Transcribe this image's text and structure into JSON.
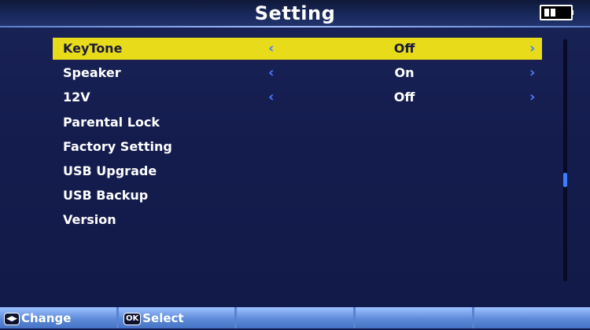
{
  "header": {
    "title": "Setting"
  },
  "status": {
    "battery_icon": "battery-icon",
    "battery_level": 0.5
  },
  "menu": {
    "items": [
      {
        "label": "KeyTone",
        "value": "Off",
        "selected": true
      },
      {
        "label": "Speaker",
        "value": "On",
        "selected": false
      },
      {
        "label": "12V",
        "value": "Off",
        "selected": false
      },
      {
        "label": "Parental Lock",
        "value": "",
        "selected": false
      },
      {
        "label": "Factory Setting",
        "value": "",
        "selected": false
      },
      {
        "label": "USB Upgrade",
        "value": "",
        "selected": false
      },
      {
        "label": "USB Backup",
        "value": "",
        "selected": false
      },
      {
        "label": "Version",
        "value": "",
        "selected": false
      }
    ]
  },
  "footer": {
    "change_key": "◀▶",
    "change_label": "Change",
    "select_key": "OK",
    "select_label": "Select"
  },
  "colors": {
    "highlight": "#e8dc1a",
    "arrow": "#4b7cff",
    "background": "#141c4e"
  }
}
